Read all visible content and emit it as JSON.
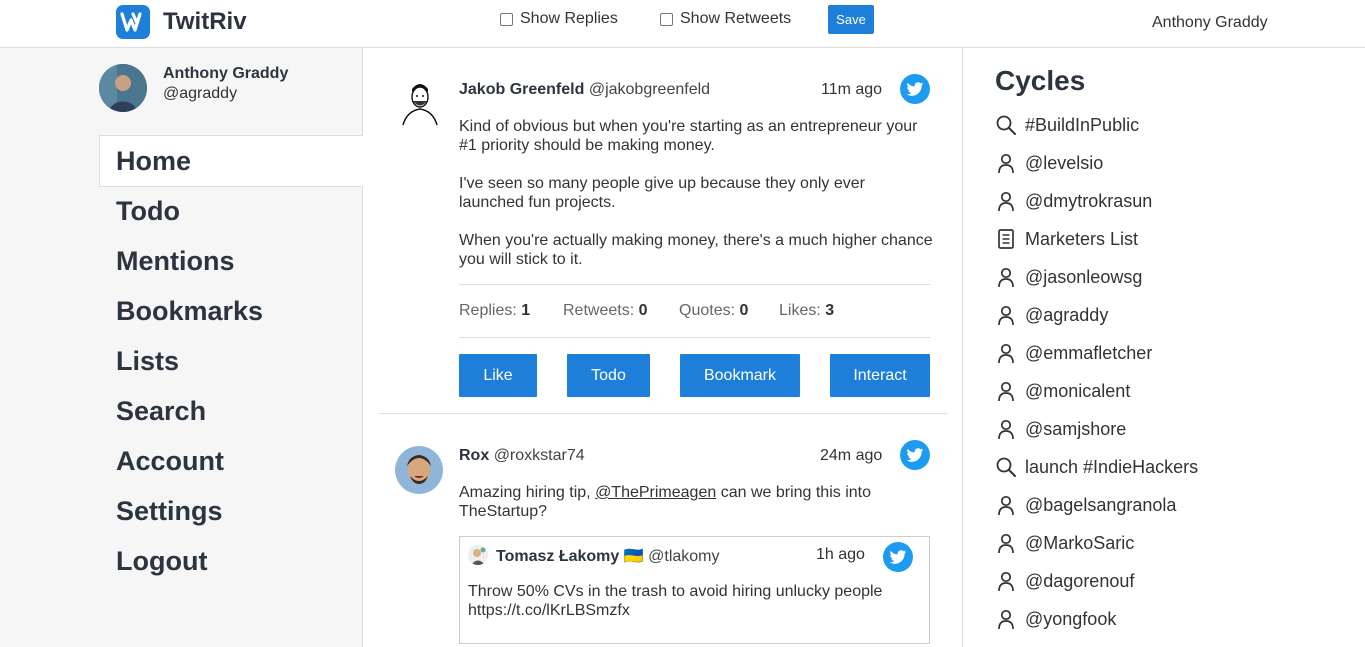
{
  "app": {
    "name": "TwitRiv"
  },
  "header": {
    "show_replies_label": "Show Replies",
    "show_retweets_label": "Show Retweets",
    "save_label": "Save",
    "user_name": "Anthony Graddy"
  },
  "profile": {
    "name": "Anthony Graddy",
    "handle": "@agraddy"
  },
  "nav": [
    {
      "label": "Home",
      "active": true
    },
    {
      "label": "Todo"
    },
    {
      "label": "Mentions"
    },
    {
      "label": "Bookmarks"
    },
    {
      "label": "Lists"
    },
    {
      "label": "Search"
    },
    {
      "label": "Account"
    },
    {
      "label": "Settings"
    },
    {
      "label": "Logout"
    }
  ],
  "tweets": [
    {
      "name": "Jakob Greenfeld",
      "handle": "@jakobgreenfeld",
      "time": "11m ago",
      "para1": "Kind of obvious but when you're starting as an entrepreneur your #1 priority should be making money.",
      "para2": "I've seen so many people give up because they only ever launched fun projects.",
      "para3": "When you're actually making money, there's a much higher chance you will stick to it.",
      "stats": {
        "replies_label": "Replies:",
        "replies": "1",
        "retweets_label": "Retweets:",
        "retweets": "0",
        "quotes_label": "Quotes:",
        "quotes": "0",
        "likes_label": "Likes:",
        "likes": "3"
      },
      "actions": {
        "like": "Like",
        "todo": "Todo",
        "bookmark": "Bookmark",
        "interact": "Interact"
      }
    },
    {
      "name": "Rox",
      "handle": "@roxkstar74",
      "time": "24m ago",
      "text_before": "Amazing hiring tip, ",
      "mention": "@ThePrimeagen",
      "text_after": " can we bring this into TheStartup?",
      "quote": {
        "name": "Tomasz Łakomy 🇺🇦",
        "handle": "@tlakomy",
        "time": "1h ago",
        "text": "Throw 50% CVs in the trash to avoid hiring unlucky people https://t.co/lKrLBSmzfx"
      }
    }
  ],
  "cycles": {
    "title": "Cycles",
    "items": [
      {
        "icon": "search-icon",
        "label": "#BuildInPublic"
      },
      {
        "icon": "user-icon",
        "label": "@levelsio"
      },
      {
        "icon": "user-icon",
        "label": "@dmytrokrasun"
      },
      {
        "icon": "list-icon",
        "label": "Marketers List"
      },
      {
        "icon": "user-icon",
        "label": "@jasonleowsg"
      },
      {
        "icon": "user-icon",
        "label": "@agraddy"
      },
      {
        "icon": "user-icon",
        "label": "@emmafletcher"
      },
      {
        "icon": "user-icon",
        "label": "@monicalent"
      },
      {
        "icon": "user-icon",
        "label": "@samjshore"
      },
      {
        "icon": "search-icon",
        "label": "launch #IndieHackers"
      },
      {
        "icon": "user-icon",
        "label": "@bagelsangranola"
      },
      {
        "icon": "user-icon",
        "label": "@MarkoSaric"
      },
      {
        "icon": "user-icon",
        "label": "@dagorenouf"
      },
      {
        "icon": "user-icon",
        "label": "@yongfook"
      }
    ]
  },
  "colors": {
    "primary": "#1d7fd9",
    "twitter": "#1d9bf0",
    "sidebar_bg": "#f6f6f6"
  }
}
